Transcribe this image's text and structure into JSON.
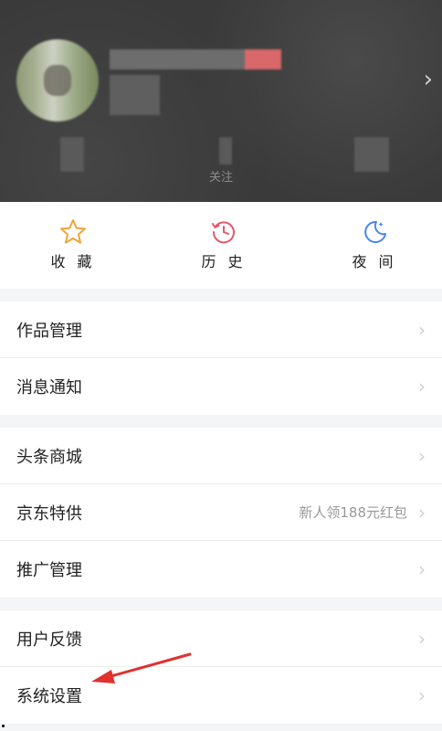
{
  "header": {
    "stat_label": "关注"
  },
  "quick_actions": [
    {
      "label": "收 藏",
      "icon": "star-icon",
      "color": "#f2a33a"
    },
    {
      "label": "历 史",
      "icon": "history-icon",
      "color": "#e05b6c"
    },
    {
      "label": "夜 间",
      "icon": "moon-icon",
      "color": "#4a86e8"
    }
  ],
  "section1": [
    {
      "label": "作品管理"
    },
    {
      "label": "消息通知"
    }
  ],
  "section2": [
    {
      "label": "头条商城"
    },
    {
      "label": "京东特供",
      "extra": "新人领188元红包"
    },
    {
      "label": "推广管理"
    }
  ],
  "section3": [
    {
      "label": "用户反馈"
    },
    {
      "label": "系统设置"
    }
  ],
  "annotation_color": "#e0312f"
}
